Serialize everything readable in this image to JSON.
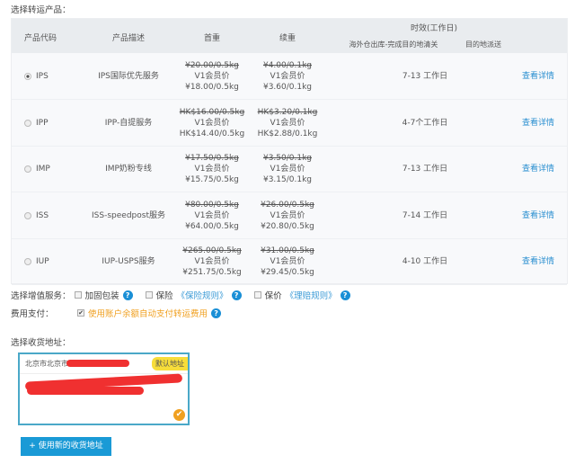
{
  "title": "选择转运产品：",
  "headers": {
    "code": "产品代码",
    "desc": "产品描述",
    "first": "首重",
    "cont": "续重",
    "time": "时效(工作日)",
    "time_sub1": "海外仓出库-完成目的地清关",
    "time_sub2": "目的地派送"
  },
  "rows": [
    {
      "code": "IPS",
      "selected": true,
      "desc": "IPS国际优先服务",
      "first_orig": "¥20.00/0.5kg",
      "first_tier": "V1会员价",
      "first_price": "¥18.00/0.5kg",
      "cont_orig": "¥4.00/0.1kg",
      "cont_tier": "V1会员价",
      "cont_price": "¥3.60/0.1kg",
      "time": "7-13 工作日",
      "link": "查看详情"
    },
    {
      "code": "IPP",
      "selected": false,
      "desc": "IPP-自提服务",
      "first_orig": "HK$16.00/0.5kg",
      "first_tier": "V1会员价",
      "first_price": "HK$14.40/0.5kg",
      "cont_orig": "HK$3.20/0.1kg",
      "cont_tier": "V1会员价",
      "cont_price": "HK$2.88/0.1kg",
      "time": "4-7个工作日",
      "link": "查看详情"
    },
    {
      "code": "IMP",
      "selected": false,
      "desc": "IMP奶粉专线",
      "first_orig": "¥17.50/0.5kg",
      "first_tier": "V1会员价",
      "first_price": "¥15.75/0.5kg",
      "cont_orig": "¥3.50/0.1kg",
      "cont_tier": "V1会员价",
      "cont_price": "¥3.15/0.1kg",
      "time": "7-13 工作日",
      "link": "查看详情"
    },
    {
      "code": "ISS",
      "selected": false,
      "desc": "ISS-speedpost服务",
      "first_orig": "¥80.00/0.5kg",
      "first_tier": "V1会员价",
      "first_price": "¥64.00/0.5kg",
      "cont_orig": "¥26.00/0.5kg",
      "cont_tier": "V1会员价",
      "cont_price": "¥20.80/0.5kg",
      "time": "7-14 工作日",
      "link": "查看详情"
    },
    {
      "code": "IUP",
      "selected": false,
      "desc": "IUP-USPS服务",
      "first_orig": "¥265.00/0.5kg",
      "first_tier": "V1会员价",
      "first_price": "¥251.75/0.5kg",
      "cont_orig": "¥31.00/0.5kg",
      "cont_tier": "V1会员价",
      "cont_price": "¥29.45/0.5kg",
      "time": "4-10 工作日",
      "link": "查看详情"
    }
  ],
  "services": {
    "label": "选择增值服务：",
    "reinforce": "加固包装",
    "insurance": "保险",
    "insurance_rule": "《保险规则》",
    "valuation": "保价",
    "claim_rule": "《理赔规则》"
  },
  "payment": {
    "label": "费用支付：",
    "text": "使用账户余额自动支付转运费用",
    "checked": true
  },
  "address": {
    "label": "选择收货地址：",
    "city": "北京市北京市",
    "badge": "默认地址"
  },
  "new_address_button": "+ 使用新的收货地址",
  "colors": {
    "accent": "#1a9ad6",
    "link": "#2a8fd0",
    "warn": "#f0a020",
    "badge": "#f7dd3a"
  }
}
